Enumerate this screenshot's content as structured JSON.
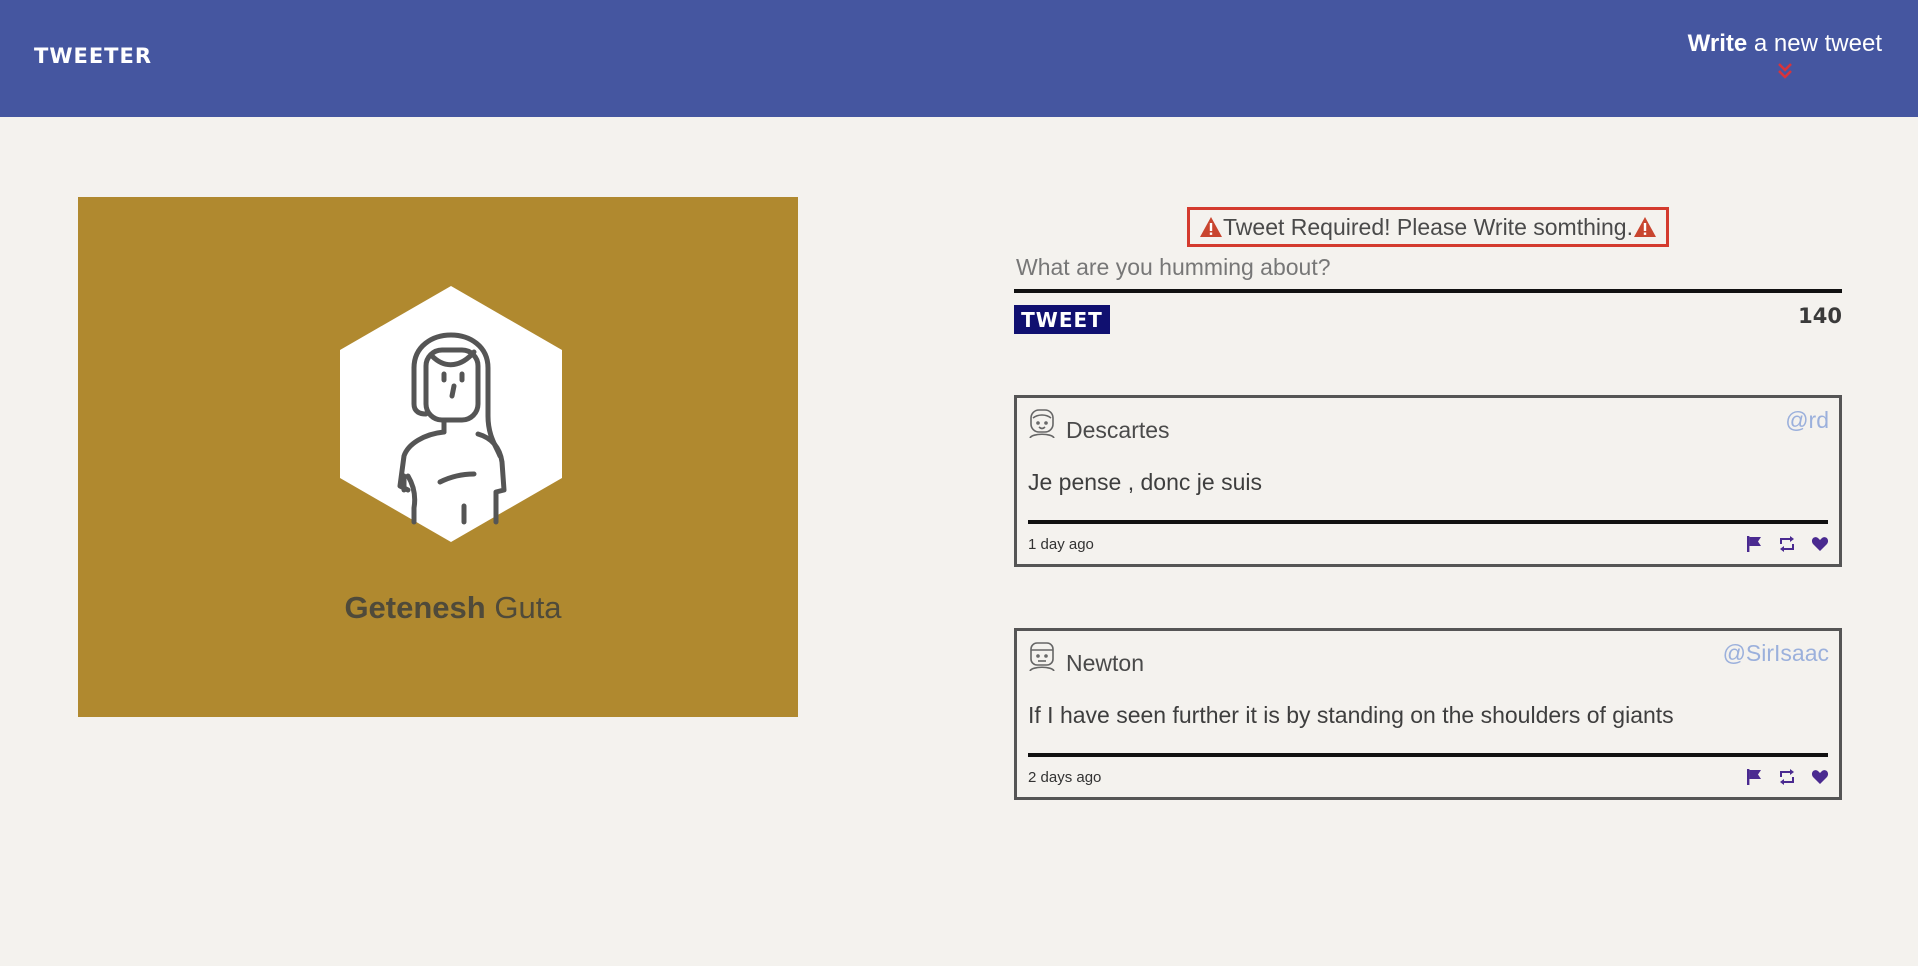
{
  "header": {
    "logo": "TWEETER",
    "compose_bold": "Write",
    "compose_rest": " a new tweet",
    "accent_color": "#4556a0"
  },
  "profile": {
    "first_name": "Getenesh",
    "last_name": "Guta",
    "card_color": "#b0892f"
  },
  "composer": {
    "error_message": "Tweet Required! Please Write somthing.",
    "placeholder": "What are you humming about?",
    "button_label": "TWEET",
    "char_counter": "140"
  },
  "tweets": [
    {
      "author": "Descartes",
      "handle": "@rd",
      "content": "Je pense , donc je suis",
      "time": "1 day ago",
      "actions": [
        "flag-icon",
        "retweet-icon",
        "heart-icon"
      ]
    },
    {
      "author": "Newton",
      "handle": "@SirIsaac",
      "content": "If I have seen further it is by standing on the shoulders of giants",
      "time": "2 days ago",
      "actions": [
        "flag-icon",
        "retweet-icon",
        "heart-icon"
      ]
    }
  ]
}
